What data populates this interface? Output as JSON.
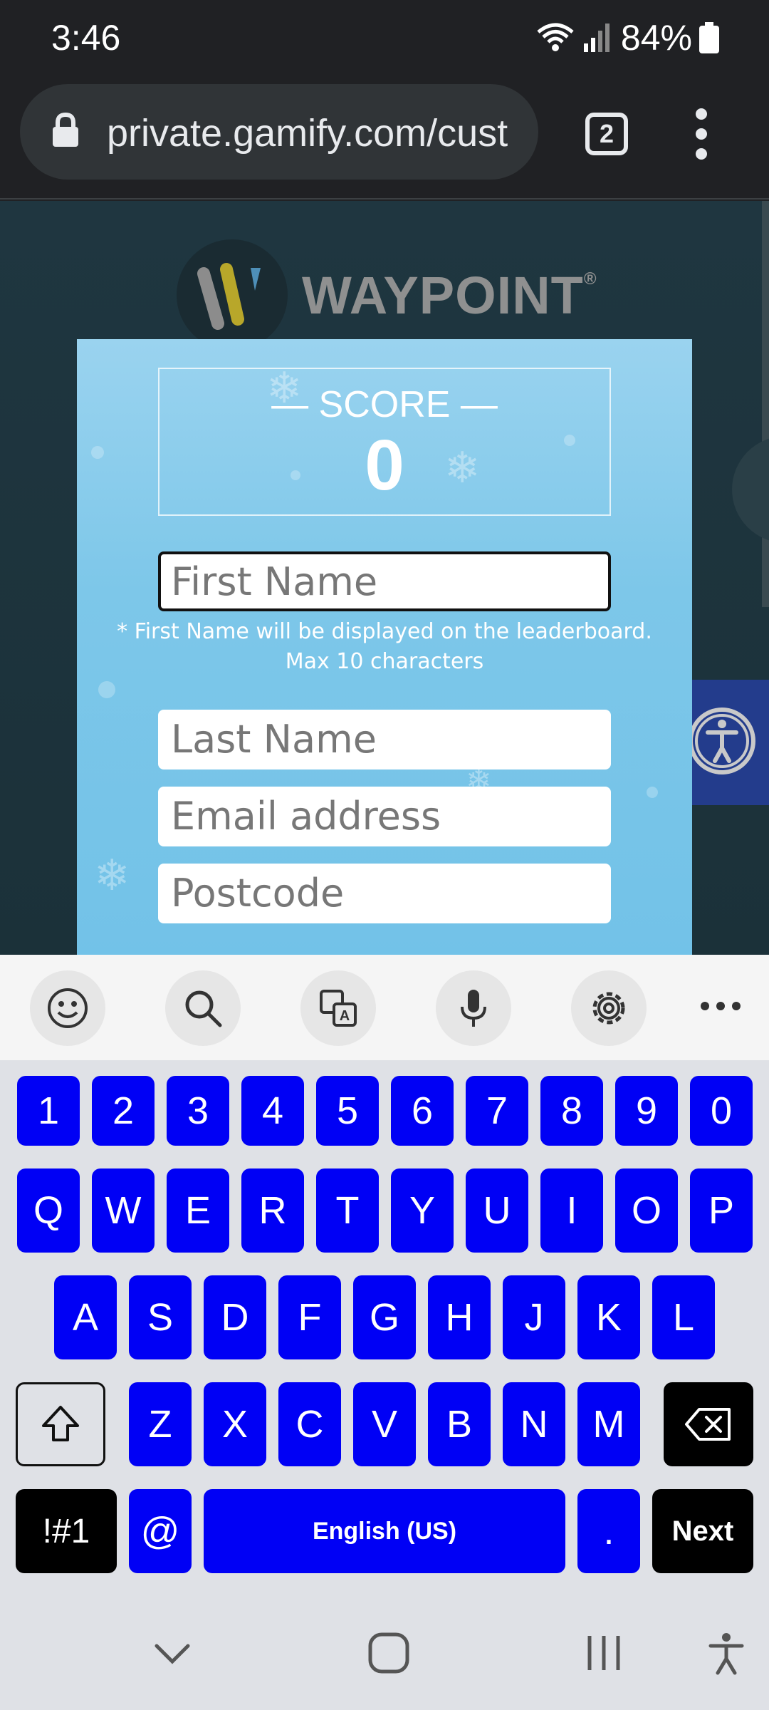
{
  "status_bar": {
    "time": "3:46",
    "battery": "84%"
  },
  "browser": {
    "url": "private.gamify.com/cust",
    "tab_count": "2"
  },
  "page": {
    "brand": "WAYPOINT",
    "brand_mark": "®",
    "score_label": "— SCORE —",
    "score_value": "0",
    "fields": {
      "first_name_placeholder": "First Name",
      "first_name_hint": "* First Name will be displayed on the leaderboard. Max 10 characters",
      "last_name_placeholder": "Last Name",
      "email_placeholder": "Email address",
      "postcode_placeholder": "Postcode"
    }
  },
  "keyboard": {
    "toolbar_icons": [
      "emoji-icon",
      "search-icon",
      "translate-icon",
      "microphone-icon",
      "settings-icon",
      "more-icon"
    ],
    "row_numbers": [
      "1",
      "2",
      "3",
      "4",
      "5",
      "6",
      "7",
      "8",
      "9",
      "0"
    ],
    "row_1": [
      "Q",
      "W",
      "E",
      "R",
      "T",
      "Y",
      "U",
      "I",
      "O",
      "P"
    ],
    "row_2": [
      "A",
      "S",
      "D",
      "F",
      "G",
      "H",
      "J",
      "K",
      "L"
    ],
    "row_3": [
      "Z",
      "X",
      "C",
      "V",
      "B",
      "N",
      "M"
    ],
    "symbols_label": "!#1",
    "at_label": "@",
    "space_label": "English (US)",
    "period_label": ".",
    "next_label": "Next",
    "key_color": "#0000f5"
  }
}
